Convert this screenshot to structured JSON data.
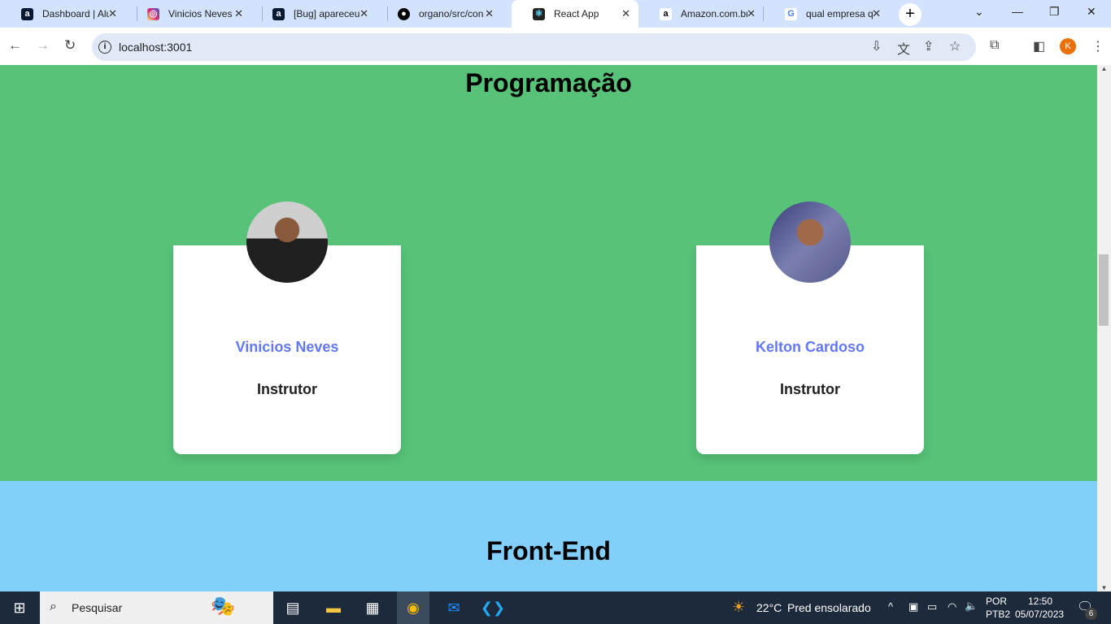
{
  "browser": {
    "tabs": [
      {
        "title": "Dashboard | Alu",
        "icon": "alura-icon",
        "color": "#051933"
      },
      {
        "title": "Vinicios Neves (",
        "icon": "instagram-icon",
        "color": "#d62976"
      },
      {
        "title": "[Bug] apareceu",
        "icon": "alura-icon",
        "color": "#051933"
      },
      {
        "title": "organo/src/con",
        "icon": "github-icon",
        "color": "#000000"
      },
      {
        "title": "React App",
        "icon": "react-icon",
        "color": "#222222",
        "active": true
      },
      {
        "title": "Amazon.com.br",
        "icon": "amazon-icon",
        "color": "#ffffff"
      },
      {
        "title": "qual empresa q",
        "icon": "google-icon",
        "color": "#ffffff"
      }
    ],
    "url": "localhost:3001",
    "profile_initial": "K"
  },
  "page": {
    "sections": [
      {
        "title": "Programação",
        "color": "#57c278",
        "members": [
          {
            "name": "Vinicios Neves",
            "role": "Instrutor"
          },
          {
            "name": "Kelton Cardoso",
            "role": "Instrutor"
          }
        ]
      },
      {
        "title": "Front-End",
        "color": "#82cffa"
      }
    ],
    "name_color": "#6278f7"
  },
  "taskbar": {
    "search_placeholder": "Pesquisar",
    "weather_temp": "22°C",
    "weather_text": "Pred ensolarado",
    "lang_top": "POR",
    "lang_bottom": "PTB2",
    "time": "12:50",
    "date": "05/07/2023",
    "notifications": "6"
  }
}
